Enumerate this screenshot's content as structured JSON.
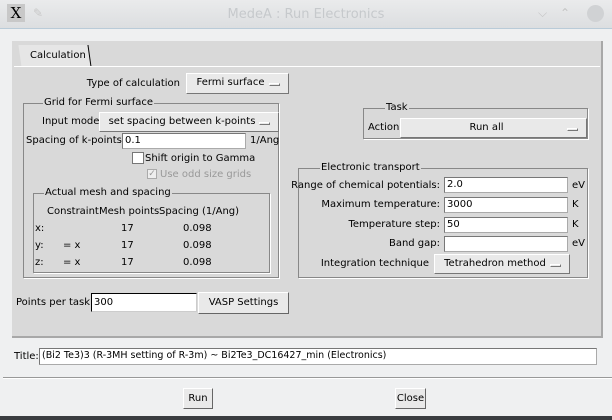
{
  "window": {
    "title": "MedeA : Run Electronics"
  },
  "tabs": [
    {
      "label": "Calculation"
    }
  ],
  "type_of_calculation": {
    "label": "Type of calculation",
    "value": "Fermi surface"
  },
  "grid": {
    "title": "Grid for Fermi surface",
    "input_mode_label": "Input mode",
    "input_mode_value": "set spacing between k-points",
    "spacing_label": "Spacing of k-points:",
    "spacing_value": "0.1",
    "spacing_unit": "1/Ang",
    "shift_origin_label": "Shift origin to Gamma",
    "shift_origin_checked": false,
    "odd_grids_label": "Use odd size grids",
    "odd_grids_checked": true,
    "mesh": {
      "title": "Actual mesh and spacing",
      "headers": [
        "Constraint",
        "Mesh points",
        "Spacing (1/Ang)"
      ],
      "rows": [
        {
          "axis": "x:",
          "constraint": "",
          "points": "17",
          "spacing": "0.098"
        },
        {
          "axis": "y:",
          "constraint": "= x",
          "points": "17",
          "spacing": "0.098"
        },
        {
          "axis": "z:",
          "constraint": "= x",
          "points": "17",
          "spacing": "0.098"
        }
      ]
    }
  },
  "task": {
    "title": "Task",
    "action_label": "Action",
    "action_value": "Run all"
  },
  "transport": {
    "title": "Electronic transport",
    "fields": [
      {
        "label": "Range of chemical potentials:",
        "value": "2.0",
        "unit": "eV"
      },
      {
        "label": "Maximum temperature:",
        "value": "3000",
        "unit": "K"
      },
      {
        "label": "Temperature step:",
        "value": "50",
        "unit": "K"
      },
      {
        "label": "Band gap:",
        "value": "",
        "unit": "eV"
      }
    ],
    "integration_label": "Integration technique",
    "integration_value": "Tetrahedron method"
  },
  "points_per_task": {
    "label": "Points per task:",
    "value": "300"
  },
  "vasp_button": "VASP Settings",
  "title_field": {
    "label": "Title:",
    "value": "(Bi2 Te3)3  (R-3MH setting of R-3m) ~ Bi2Te3_DC16427_min (Electronics)"
  },
  "buttons": {
    "run": "Run",
    "close": "Close"
  }
}
